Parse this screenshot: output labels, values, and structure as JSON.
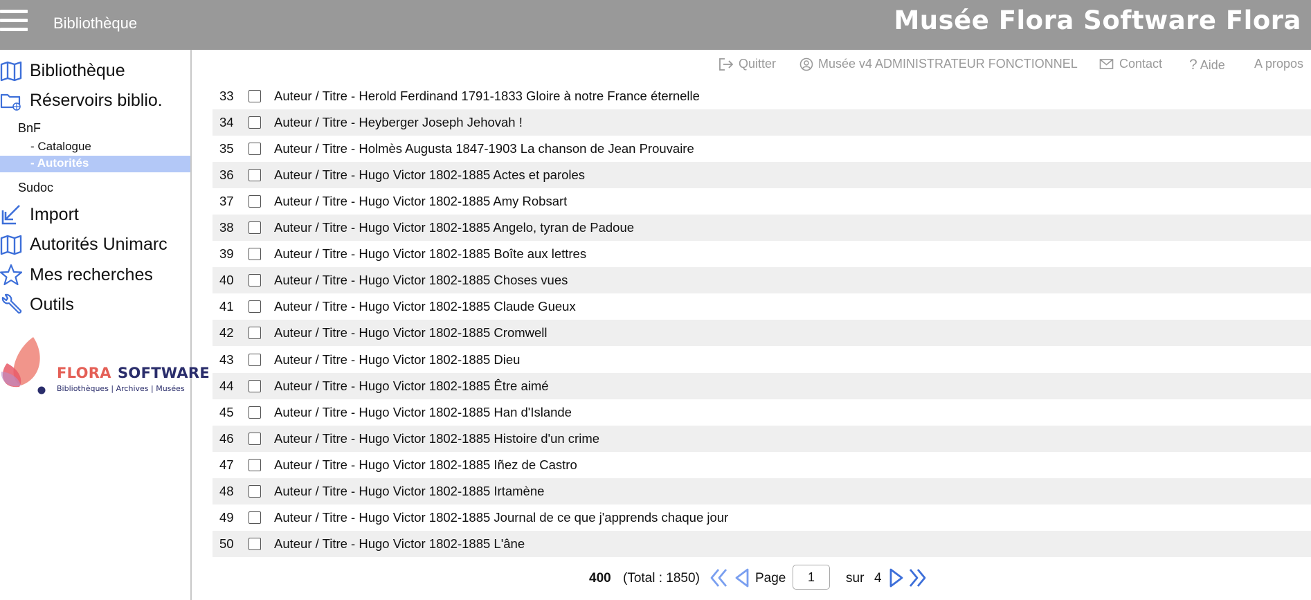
{
  "header": {
    "module": "Bibliothèque",
    "title": "Musée Flora Software Flora"
  },
  "sidebar": {
    "items": [
      {
        "label": "Bibliothèque",
        "icon": "book-icon"
      },
      {
        "label": "Réservoirs biblio.",
        "icon": "folder-globe-icon"
      },
      {
        "label": "Import",
        "icon": "import-arrow-icon"
      },
      {
        "label": "Autorités Unimarc",
        "icon": "book-icon"
      },
      {
        "label": "Mes recherches",
        "icon": "star-icon"
      },
      {
        "label": "Outils",
        "icon": "wrench-icon"
      }
    ],
    "bnf": {
      "label": "BnF",
      "catalogue": "- Catalogue",
      "autorites": "- Autorités"
    },
    "sudoc": "Sudoc",
    "logo": {
      "brand_a": "FLORA",
      "brand_b": "SOFTWARE",
      "tagline": "Bibliothèques | Archives | Musées"
    }
  },
  "toolbar": {
    "quit": "Quitter",
    "user": "Musée v4 ADMINISTRATEUR FONCTIONNEL",
    "contact": "Contact",
    "help": "Aide",
    "about": "A propos"
  },
  "results": [
    {
      "num": "33",
      "text": "Auteur / Titre  - Herold Ferdinand 1791-1833 Gloire à notre France éternelle"
    },
    {
      "num": "34",
      "text": "Auteur / Titre  - Heyberger Joseph Jehovah !"
    },
    {
      "num": "35",
      "text": "Auteur / Titre  - Holmès Augusta 1847-1903 La chanson de Jean Prouvaire"
    },
    {
      "num": "36",
      "text": "Auteur / Titre  - Hugo Victor 1802-1885 Actes et paroles"
    },
    {
      "num": "37",
      "text": "Auteur / Titre  - Hugo Victor 1802-1885 Amy Robsart"
    },
    {
      "num": "38",
      "text": "Auteur / Titre  - Hugo Victor 1802-1885 Angelo, tyran de Padoue"
    },
    {
      "num": "39",
      "text": "Auteur / Titre  - Hugo Victor 1802-1885 Boîte aux lettres"
    },
    {
      "num": "40",
      "text": "Auteur / Titre  - Hugo Victor 1802-1885 Choses vues"
    },
    {
      "num": "41",
      "text": "Auteur / Titre  - Hugo Victor 1802-1885 Claude Gueux"
    },
    {
      "num": "42",
      "text": "Auteur / Titre  - Hugo Victor 1802-1885 Cromwell"
    },
    {
      "num": "43",
      "text": "Auteur / Titre  - Hugo Victor 1802-1885 Dieu"
    },
    {
      "num": "44",
      "text": "Auteur / Titre  - Hugo Victor 1802-1885 Être aimé"
    },
    {
      "num": "45",
      "text": "Auteur / Titre  - Hugo Victor 1802-1885 Han d'Islande"
    },
    {
      "num": "46",
      "text": "Auteur / Titre  - Hugo Victor 1802-1885 Histoire d'un crime"
    },
    {
      "num": "47",
      "text": "Auteur / Titre  - Hugo Victor 1802-1885 Iñez de Castro"
    },
    {
      "num": "48",
      "text": "Auteur / Titre  - Hugo Victor 1802-1885 Irtamène"
    },
    {
      "num": "49",
      "text": "Auteur / Titre  - Hugo Victor 1802-1885 Journal de ce que j'apprends chaque jour"
    },
    {
      "num": "50",
      "text": "Auteur / Titre  - Hugo Victor 1802-1885 L'âne"
    }
  ],
  "pagination": {
    "count": "400",
    "total": "(Total : 1850)",
    "page_label": "Page",
    "page_value": "1",
    "sur_label": "sur",
    "total_pages": "4"
  },
  "colors": {
    "header_bg": "#999999",
    "active_bg": "#b3c8f7",
    "icon_blue": "#3d6fd9",
    "row_alt": "#efefef",
    "logo_red": "#e45f56",
    "logo_navy": "#2a2d6b"
  }
}
